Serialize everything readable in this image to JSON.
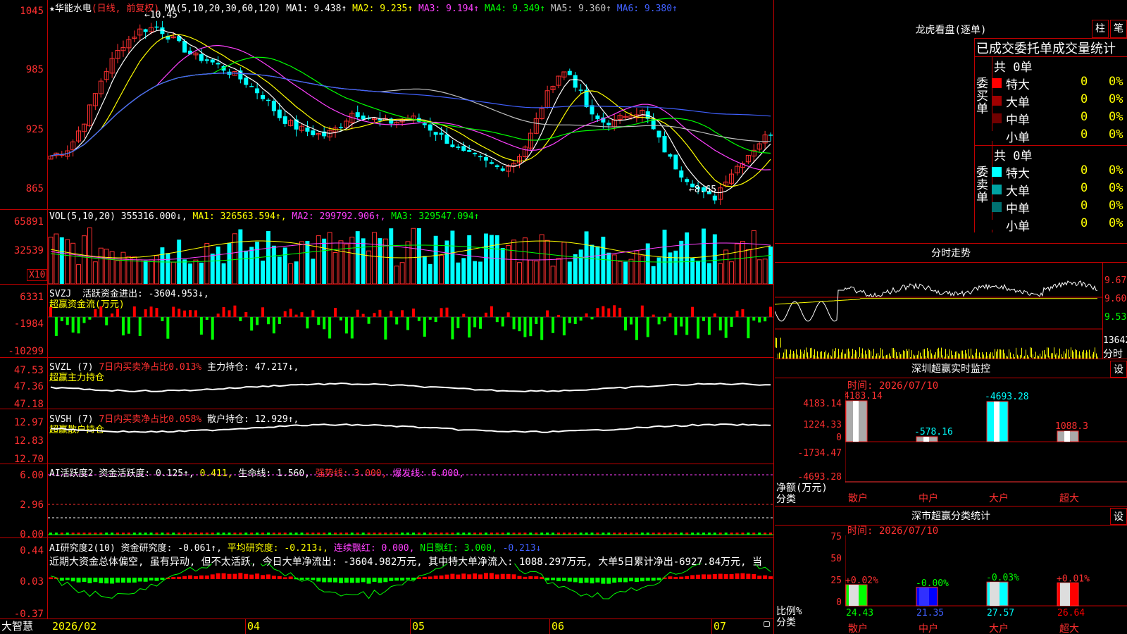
{
  "app": {
    "name": "大智慧",
    "footer_date": "2026/02"
  },
  "stock": {
    "star": "★",
    "name": "华能水电",
    "period": "(日线, 前复权)",
    "ma_header": "MA(5,10,20,30,60,120)",
    "ma": [
      {
        "label": "MA1:",
        "value": "9.438↑",
        "color": "#ffffff"
      },
      {
        "label": "MA2:",
        "value": "9.235↑",
        "color": "#ffff00"
      },
      {
        "label": "MA3:",
        "value": "9.194↑",
        "color": "#ff40ff"
      },
      {
        "label": "MA4:",
        "value": "9.349↑",
        "color": "#00ff00"
      },
      {
        "label": "MA5:",
        "value": "9.360↑",
        "color": "#c0c0c0"
      },
      {
        "label": "MA6:",
        "value": "9.380↑",
        "color": "#4060ff"
      }
    ],
    "high_mark": "10.45",
    "low_mark": "8.65",
    "price_axis": [
      "1045",
      "985",
      "925",
      "865"
    ]
  },
  "vol": {
    "header": "VOL(5,10,20)",
    "value": "355316.000↓,",
    "ma1": "MA1: 326563.594↑,",
    "ma2": "MA2: 299792.906↑,",
    "ma3": "MA3: 329547.094↑",
    "axis": [
      "65891",
      "32539"
    ],
    "unit": "X10"
  },
  "svzj": {
    "header": "SVZJ",
    "text": "活跃资金进出: -3604.953↓,",
    "subtitle": "超赢资金流(万元)",
    "axis": [
      "6331",
      "-1984",
      "-10299"
    ]
  },
  "svzl": {
    "header": "SVZL (7)",
    "ratio": "7日内买卖净占比0.013%",
    "text": "主力持仓: 47.217↓,",
    "subtitle": "超赢主力持仓",
    "axis": [
      "47.53",
      "47.36",
      "47.18"
    ]
  },
  "svsh": {
    "header": "SVSH (7)",
    "ratio": "7日内买卖净占比0.058%",
    "text": "散户持仓: 12.929↑,",
    "subtitle": "超赢散户持仓",
    "axis": [
      "12.97",
      "12.83",
      "12.70"
    ]
  },
  "ai1": {
    "header": "AI活跃度2",
    "text1": "资金活跃度: 0.125↑,",
    "text2": "0.411,",
    "text3": "生命线: 1.560,",
    "text4": "强势线: 3.000,",
    "text5": "爆发线: 6.000,",
    "axis": [
      "6.00",
      "2.96",
      "0.00"
    ]
  },
  "ai2": {
    "header": "AI研究度2(10)",
    "text1": "资金研究度: -0.061↑,",
    "text2": "平均研究度: -0.213↓,",
    "text3": "连续飘红: 0.000,",
    "text4": "N日飘红: 3.000,",
    "text5": "-0.213↓",
    "summary": "近期大资金总体偏空, 虽有异动, 但不太活跃, 今日大单净流出: -3604.982万元, 其中特大单净流入: 1088.297万元, 大单5日累计净出-6927.84万元, 当",
    "axis": [
      "0.44",
      "0.03",
      "-0.37"
    ]
  },
  "x_axis": [
    "04",
    "05",
    "06",
    "07"
  ],
  "longhu": {
    "title": "龙虎看盘(逐单)",
    "btn1": "柱",
    "btn2": "笔",
    "tabs": "已成交委托单成交量统计",
    "buy_label": "委买单",
    "sell_label": "委卖单",
    "buy_total": "共 0单",
    "sell_total": "共 0单",
    "buy_rows": [
      {
        "name": "特大",
        "count": "0",
        "pct": "0%",
        "color": "#ff0000"
      },
      {
        "name": "大单",
        "count": "0",
        "pct": "0%",
        "color": "#a00000"
      },
      {
        "name": "中单",
        "count": "0",
        "pct": "0%",
        "color": "#700000"
      },
      {
        "name": "小单",
        "count": "0",
        "pct": "0%",
        "color": "#000000"
      }
    ],
    "sell_rows": [
      {
        "name": "特大",
        "count": "0",
        "pct": "0%",
        "color": "#00ffff"
      },
      {
        "name": "大单",
        "count": "0",
        "pct": "0%",
        "color": "#00a0a0"
      },
      {
        "name": "中单",
        "count": "0",
        "pct": "0%",
        "color": "#007070"
      },
      {
        "name": "小单",
        "count": "0",
        "pct": "0%",
        "color": "#000000"
      }
    ]
  },
  "fenshi": {
    "title": "分时走势",
    "axis": [
      "9.67",
      "9.60",
      "9.53"
    ],
    "vol_axis": [
      "13642",
      "分时"
    ]
  },
  "sz_monitor": {
    "title": "深圳超赢实时监控",
    "btn": "设",
    "time": "时间: 2026/07/10",
    "axis": [
      "4183.14",
      "1224.33",
      "0",
      "-1734.47",
      "-4693.28"
    ],
    "unit": "净额(万元)",
    "cat_label": "分类",
    "categories": [
      "散户",
      "中户",
      "大户",
      "超大"
    ],
    "values": [
      4183.14,
      -578.16,
      -4693.28,
      1088.3
    ],
    "value_labels": [
      "4183.14",
      "-578.16",
      "-4693.28",
      "1088.3"
    ]
  },
  "sz_class": {
    "title": "深市超赢分类统计",
    "btn": "设",
    "time": "时间: 2026/07/10",
    "axis": [
      "75",
      "50",
      "25",
      "0"
    ],
    "unit": "比例%",
    "cat_label": "分类",
    "categories": [
      "散户",
      "中户",
      "大户",
      "超大"
    ],
    "values": [
      24.43,
      21.35,
      27.57,
      26.64
    ],
    "changes": [
      "+0.02%",
      "-0.00%",
      "-0.03%",
      "+0.01%"
    ],
    "change_colors": [
      "#ff3030",
      "#00ff00",
      "#00ff00",
      "#ff3030"
    ],
    "bar_colors": [
      "#00ff00",
      "#0000ff",
      "#00ffff",
      "#ff0000"
    ]
  }
}
